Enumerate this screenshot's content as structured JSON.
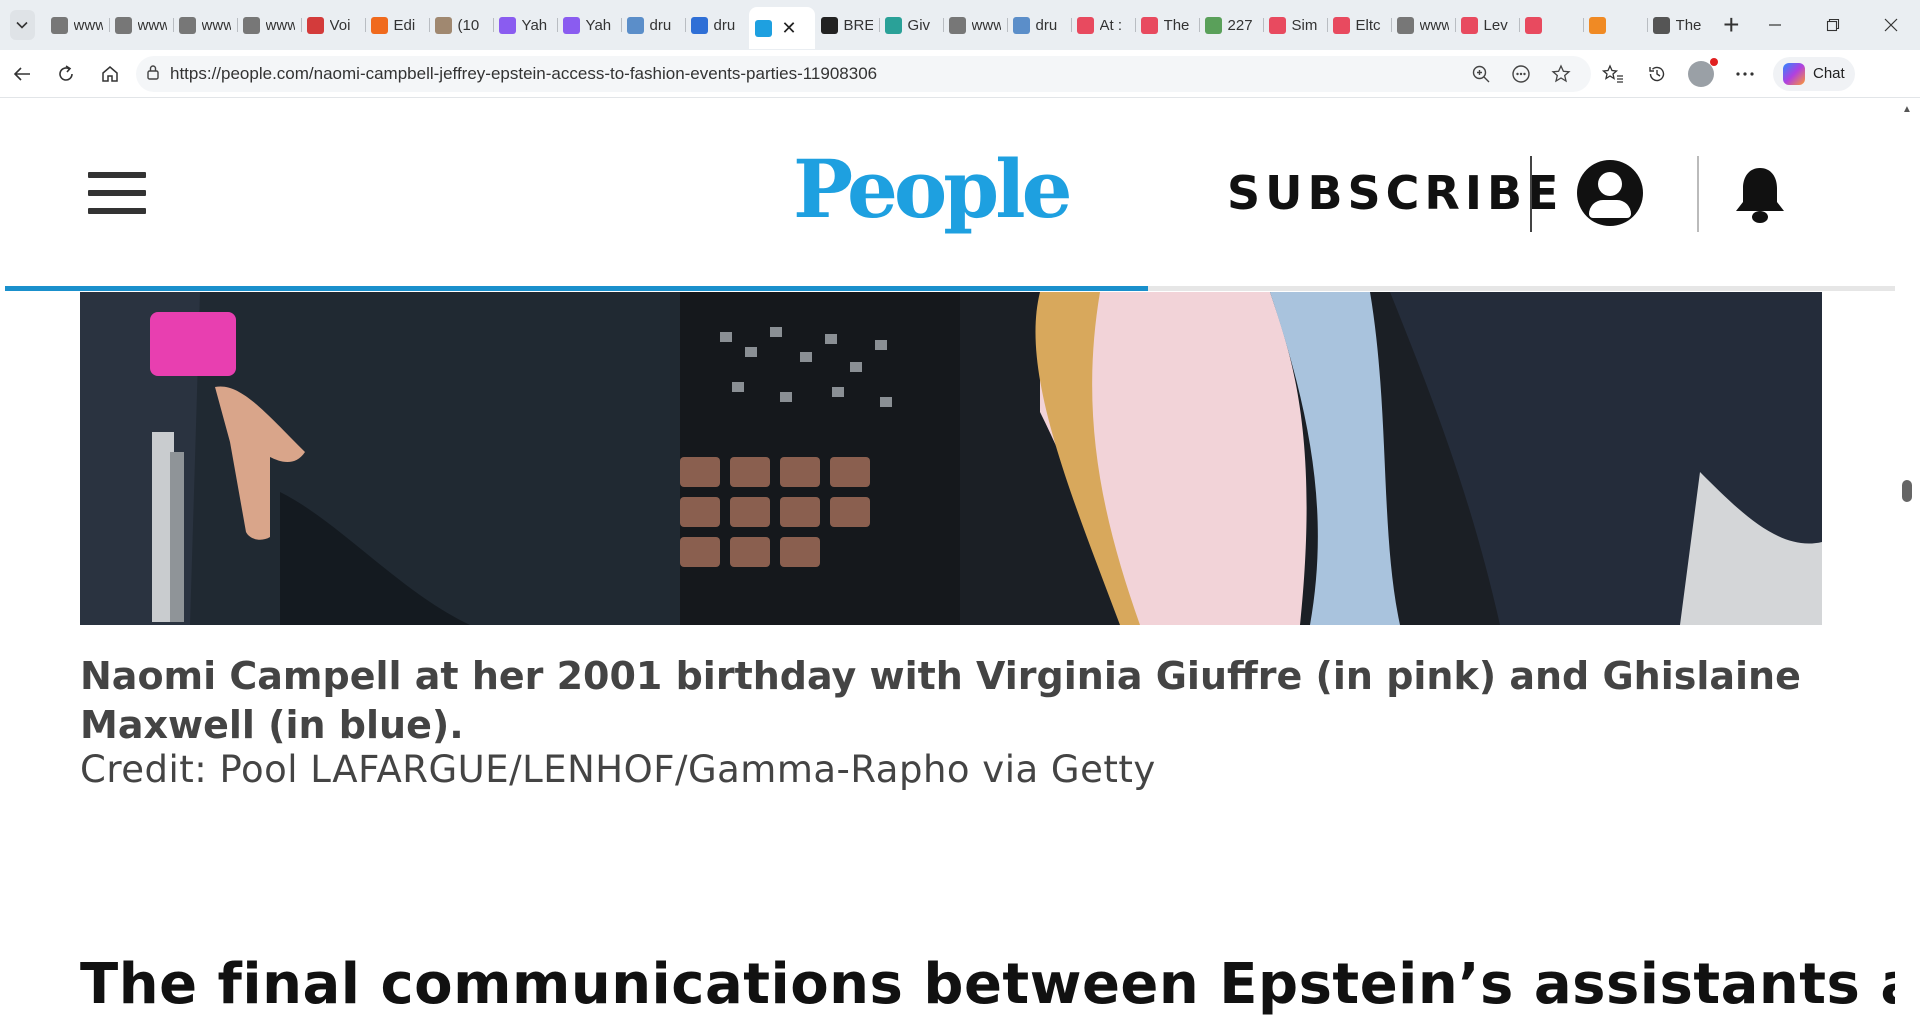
{
  "browser": {
    "tabs": [
      {
        "label": "www",
        "icon": "page-icon",
        "color": "#777777"
      },
      {
        "label": "www",
        "icon": "page-icon",
        "color": "#777777"
      },
      {
        "label": "www",
        "icon": "page-icon",
        "color": "#777777"
      },
      {
        "label": "www",
        "icon": "page-icon",
        "color": "#777777"
      },
      {
        "label": "Voi",
        "icon": "pdf-icon",
        "color": "#d33b3b"
      },
      {
        "label": "Edi",
        "icon": "blogger-icon",
        "color": "#f06a1d"
      },
      {
        "label": "(10",
        "icon": "photo-icon",
        "color": "#a08870"
      },
      {
        "label": "Yah",
        "icon": "yahoo-icon",
        "color": "#8a5cf0"
      },
      {
        "label": "Yah",
        "icon": "yahoo-icon",
        "color": "#8a5cf0"
      },
      {
        "label": "dru",
        "icon": "search-icon",
        "color": "#5b8ec9"
      },
      {
        "label": "dru",
        "icon": "search-icon",
        "color": "#2f6fd6"
      },
      {
        "label": "",
        "icon": "people-icon",
        "color": "#1ea0e0",
        "active": true
      },
      {
        "label": "BRE",
        "icon": "fp-icon",
        "color": "#222222"
      },
      {
        "label": "Giv",
        "icon": "snowflake-icon",
        "color": "#2aa198"
      },
      {
        "label": "www",
        "icon": "page-icon",
        "color": "#777777"
      },
      {
        "label": "dru",
        "icon": "search-icon",
        "color": "#5b8ec9"
      },
      {
        "label": "At :",
        "icon": "youtube-icon",
        "color": "#e84a5f"
      },
      {
        "label": "The",
        "icon": "youtube-icon",
        "color": "#e84a5f"
      },
      {
        "label": "227",
        "icon": "sheet-icon",
        "color": "#5aa05a"
      },
      {
        "label": "Sim",
        "icon": "youtube-icon",
        "color": "#e84a5f"
      },
      {
        "label": "Eltc",
        "icon": "youtube-icon",
        "color": "#e84a5f"
      },
      {
        "label": "www",
        "icon": "page-icon",
        "color": "#777777"
      },
      {
        "label": "Lev",
        "icon": "youtube-icon",
        "color": "#e84a5f"
      },
      {
        "label": "",
        "icon": "youtube-icon",
        "color": "#e84a5f"
      },
      {
        "label": "",
        "icon": "flash-icon",
        "color": "#f08a24"
      },
      {
        "label": "The",
        "icon": "s-icon",
        "color": "#555555"
      }
    ],
    "active_tab_close": "✕",
    "new_tab": "+",
    "url": "https://people.com/naomi-campbell-jeffrey-epstein-access-to-fashion-events-parties-11908306",
    "copilot_label": "Chat"
  },
  "site": {
    "logo_text": "People",
    "brand_color": "#1ea0e0",
    "subscribe_label": "SUBSCRIBE",
    "read_progress": 0.605
  },
  "article": {
    "caption": "Naomi Campell at her 2001 birthday with Virginia Giuffre (in pink) and Ghislaine Maxwell (in blue).",
    "credit": "Credit: Pool LAFARGUE/LENHOF/Gamma-Rapho via Getty",
    "heading": "The final communications between Epstein’s assistants and Campbell"
  }
}
